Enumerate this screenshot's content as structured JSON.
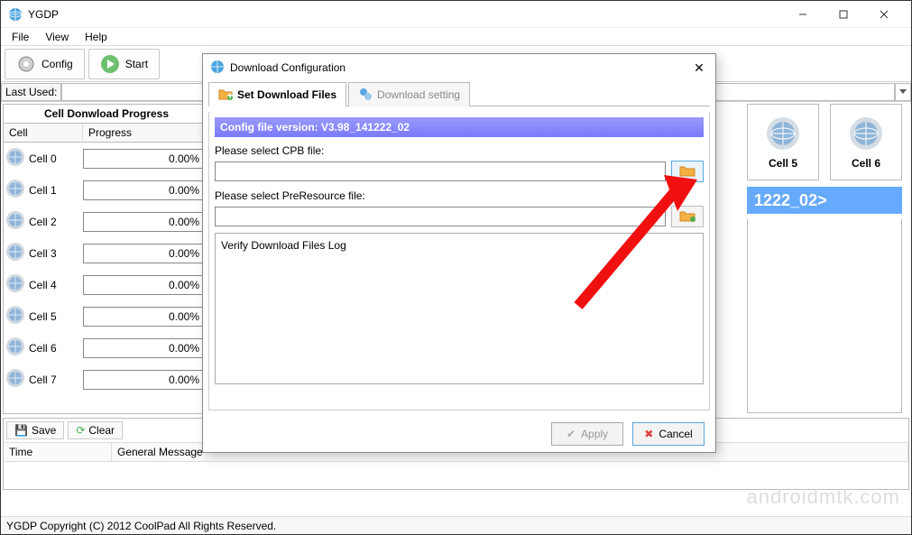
{
  "app": {
    "title": "YGDP"
  },
  "menu": {
    "file": "File",
    "view": "View",
    "help": "Help"
  },
  "toolbar": {
    "config": "Config",
    "start": "Start"
  },
  "lastused": {
    "label": "Last Used:",
    "value": ""
  },
  "progress_panel": {
    "title": "Cell Donwload Progress",
    "col_cell": "Cell",
    "col_progress": "Progress",
    "rows": [
      {
        "name": "Cell 0",
        "pct": "0.00%"
      },
      {
        "name": "Cell 1",
        "pct": "0.00%"
      },
      {
        "name": "Cell 2",
        "pct": "0.00%"
      },
      {
        "name": "Cell 3",
        "pct": "0.00%"
      },
      {
        "name": "Cell 4",
        "pct": "0.00%"
      },
      {
        "name": "Cell 5",
        "pct": "0.00%"
      },
      {
        "name": "Cell 6",
        "pct": "0.00%"
      },
      {
        "name": "Cell 7",
        "pct": "0.00%"
      }
    ]
  },
  "right_cells": {
    "c5": "Cell 5",
    "c6": "Cell 6"
  },
  "version_strip": "1222_02>",
  "log": {
    "save": "Save",
    "clear": "Clear",
    "col_time": "Time",
    "col_msg": "General Message"
  },
  "footer": "YGDP Copyright (C) 2012 CoolPad All Rights Reserved.",
  "watermark": "androidmtk.com",
  "modal": {
    "title": "Download Configuration",
    "tab1": "Set Download Files",
    "tab2": "Download setting",
    "cfg_bar": "Config file version: V3.98_141222_02",
    "cpb_label": "Please select CPB file:",
    "cpb_value": "",
    "pre_label": "Please select PreResource file:",
    "pre_value": "",
    "verify_label": "Verify Download Files Log",
    "apply": "Apply",
    "cancel": "Cancel"
  },
  "icons": {
    "globe": "globe-icon",
    "folder": "folder-icon",
    "gear": "gear-icon",
    "play": "play-icon"
  }
}
